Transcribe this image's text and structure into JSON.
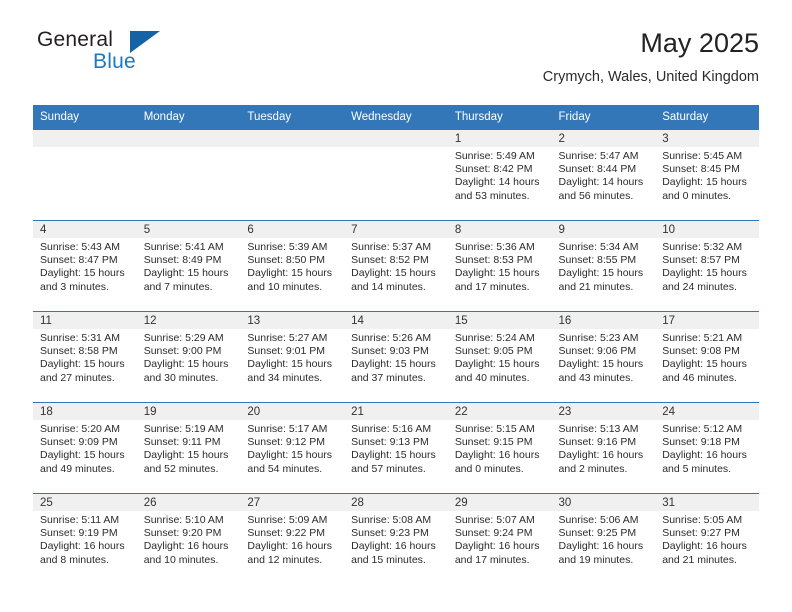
{
  "brand": {
    "name_part1": "General",
    "name_part2": "Blue",
    "triangle_color": "#1363a5"
  },
  "header": {
    "title": "May 2025",
    "subtitle": "Crymych, Wales, United Kingdom",
    "accent_color": "#3477b8",
    "daynum_band_color": "#f0f0f0"
  },
  "weekdays": [
    "Sunday",
    "Monday",
    "Tuesday",
    "Wednesday",
    "Thursday",
    "Friday",
    "Saturday"
  ],
  "weeks": [
    [
      {
        "day": "",
        "sunrise": "",
        "sunset": "",
        "daylight": "",
        "empty": true
      },
      {
        "day": "",
        "sunrise": "",
        "sunset": "",
        "daylight": "",
        "empty": true
      },
      {
        "day": "",
        "sunrise": "",
        "sunset": "",
        "daylight": "",
        "empty": true
      },
      {
        "day": "",
        "sunrise": "",
        "sunset": "",
        "daylight": "",
        "empty": true
      },
      {
        "day": "1",
        "sunrise": "Sunrise: 5:49 AM",
        "sunset": "Sunset: 8:42 PM",
        "daylight": "Daylight: 14 hours and 53 minutes.",
        "empty": false
      },
      {
        "day": "2",
        "sunrise": "Sunrise: 5:47 AM",
        "sunset": "Sunset: 8:44 PM",
        "daylight": "Daylight: 14 hours and 56 minutes.",
        "empty": false
      },
      {
        "day": "3",
        "sunrise": "Sunrise: 5:45 AM",
        "sunset": "Sunset: 8:45 PM",
        "daylight": "Daylight: 15 hours and 0 minutes.",
        "empty": false
      }
    ],
    [
      {
        "day": "4",
        "sunrise": "Sunrise: 5:43 AM",
        "sunset": "Sunset: 8:47 PM",
        "daylight": "Daylight: 15 hours and 3 minutes.",
        "empty": false
      },
      {
        "day": "5",
        "sunrise": "Sunrise: 5:41 AM",
        "sunset": "Sunset: 8:49 PM",
        "daylight": "Daylight: 15 hours and 7 minutes.",
        "empty": false
      },
      {
        "day": "6",
        "sunrise": "Sunrise: 5:39 AM",
        "sunset": "Sunset: 8:50 PM",
        "daylight": "Daylight: 15 hours and 10 minutes.",
        "empty": false
      },
      {
        "day": "7",
        "sunrise": "Sunrise: 5:37 AM",
        "sunset": "Sunset: 8:52 PM",
        "daylight": "Daylight: 15 hours and 14 minutes.",
        "empty": false
      },
      {
        "day": "8",
        "sunrise": "Sunrise: 5:36 AM",
        "sunset": "Sunset: 8:53 PM",
        "daylight": "Daylight: 15 hours and 17 minutes.",
        "empty": false
      },
      {
        "day": "9",
        "sunrise": "Sunrise: 5:34 AM",
        "sunset": "Sunset: 8:55 PM",
        "daylight": "Daylight: 15 hours and 21 minutes.",
        "empty": false
      },
      {
        "day": "10",
        "sunrise": "Sunrise: 5:32 AM",
        "sunset": "Sunset: 8:57 PM",
        "daylight": "Daylight: 15 hours and 24 minutes.",
        "empty": false
      }
    ],
    [
      {
        "day": "11",
        "sunrise": "Sunrise: 5:31 AM",
        "sunset": "Sunset: 8:58 PM",
        "daylight": "Daylight: 15 hours and 27 minutes.",
        "empty": false
      },
      {
        "day": "12",
        "sunrise": "Sunrise: 5:29 AM",
        "sunset": "Sunset: 9:00 PM",
        "daylight": "Daylight: 15 hours and 30 minutes.",
        "empty": false
      },
      {
        "day": "13",
        "sunrise": "Sunrise: 5:27 AM",
        "sunset": "Sunset: 9:01 PM",
        "daylight": "Daylight: 15 hours and 34 minutes.",
        "empty": false
      },
      {
        "day": "14",
        "sunrise": "Sunrise: 5:26 AM",
        "sunset": "Sunset: 9:03 PM",
        "daylight": "Daylight: 15 hours and 37 minutes.",
        "empty": false
      },
      {
        "day": "15",
        "sunrise": "Sunrise: 5:24 AM",
        "sunset": "Sunset: 9:05 PM",
        "daylight": "Daylight: 15 hours and 40 minutes.",
        "empty": false
      },
      {
        "day": "16",
        "sunrise": "Sunrise: 5:23 AM",
        "sunset": "Sunset: 9:06 PM",
        "daylight": "Daylight: 15 hours and 43 minutes.",
        "empty": false
      },
      {
        "day": "17",
        "sunrise": "Sunrise: 5:21 AM",
        "sunset": "Sunset: 9:08 PM",
        "daylight": "Daylight: 15 hours and 46 minutes.",
        "empty": false
      }
    ],
    [
      {
        "day": "18",
        "sunrise": "Sunrise: 5:20 AM",
        "sunset": "Sunset: 9:09 PM",
        "daylight": "Daylight: 15 hours and 49 minutes.",
        "empty": false
      },
      {
        "day": "19",
        "sunrise": "Sunrise: 5:19 AM",
        "sunset": "Sunset: 9:11 PM",
        "daylight": "Daylight: 15 hours and 52 minutes.",
        "empty": false
      },
      {
        "day": "20",
        "sunrise": "Sunrise: 5:17 AM",
        "sunset": "Sunset: 9:12 PM",
        "daylight": "Daylight: 15 hours and 54 minutes.",
        "empty": false
      },
      {
        "day": "21",
        "sunrise": "Sunrise: 5:16 AM",
        "sunset": "Sunset: 9:13 PM",
        "daylight": "Daylight: 15 hours and 57 minutes.",
        "empty": false
      },
      {
        "day": "22",
        "sunrise": "Sunrise: 5:15 AM",
        "sunset": "Sunset: 9:15 PM",
        "daylight": "Daylight: 16 hours and 0 minutes.",
        "empty": false
      },
      {
        "day": "23",
        "sunrise": "Sunrise: 5:13 AM",
        "sunset": "Sunset: 9:16 PM",
        "daylight": "Daylight: 16 hours and 2 minutes.",
        "empty": false
      },
      {
        "day": "24",
        "sunrise": "Sunrise: 5:12 AM",
        "sunset": "Sunset: 9:18 PM",
        "daylight": "Daylight: 16 hours and 5 minutes.",
        "empty": false
      }
    ],
    [
      {
        "day": "25",
        "sunrise": "Sunrise: 5:11 AM",
        "sunset": "Sunset: 9:19 PM",
        "daylight": "Daylight: 16 hours and 8 minutes.",
        "empty": false
      },
      {
        "day": "26",
        "sunrise": "Sunrise: 5:10 AM",
        "sunset": "Sunset: 9:20 PM",
        "daylight": "Daylight: 16 hours and 10 minutes.",
        "empty": false
      },
      {
        "day": "27",
        "sunrise": "Sunrise: 5:09 AM",
        "sunset": "Sunset: 9:22 PM",
        "daylight": "Daylight: 16 hours and 12 minutes.",
        "empty": false
      },
      {
        "day": "28",
        "sunrise": "Sunrise: 5:08 AM",
        "sunset": "Sunset: 9:23 PM",
        "daylight": "Daylight: 16 hours and 15 minutes.",
        "empty": false
      },
      {
        "day": "29",
        "sunrise": "Sunrise: 5:07 AM",
        "sunset": "Sunset: 9:24 PM",
        "daylight": "Daylight: 16 hours and 17 minutes.",
        "empty": false
      },
      {
        "day": "30",
        "sunrise": "Sunrise: 5:06 AM",
        "sunset": "Sunset: 9:25 PM",
        "daylight": "Daylight: 16 hours and 19 minutes.",
        "empty": false
      },
      {
        "day": "31",
        "sunrise": "Sunrise: 5:05 AM",
        "sunset": "Sunset: 9:27 PM",
        "daylight": "Daylight: 16 hours and 21 minutes.",
        "empty": false
      }
    ]
  ]
}
